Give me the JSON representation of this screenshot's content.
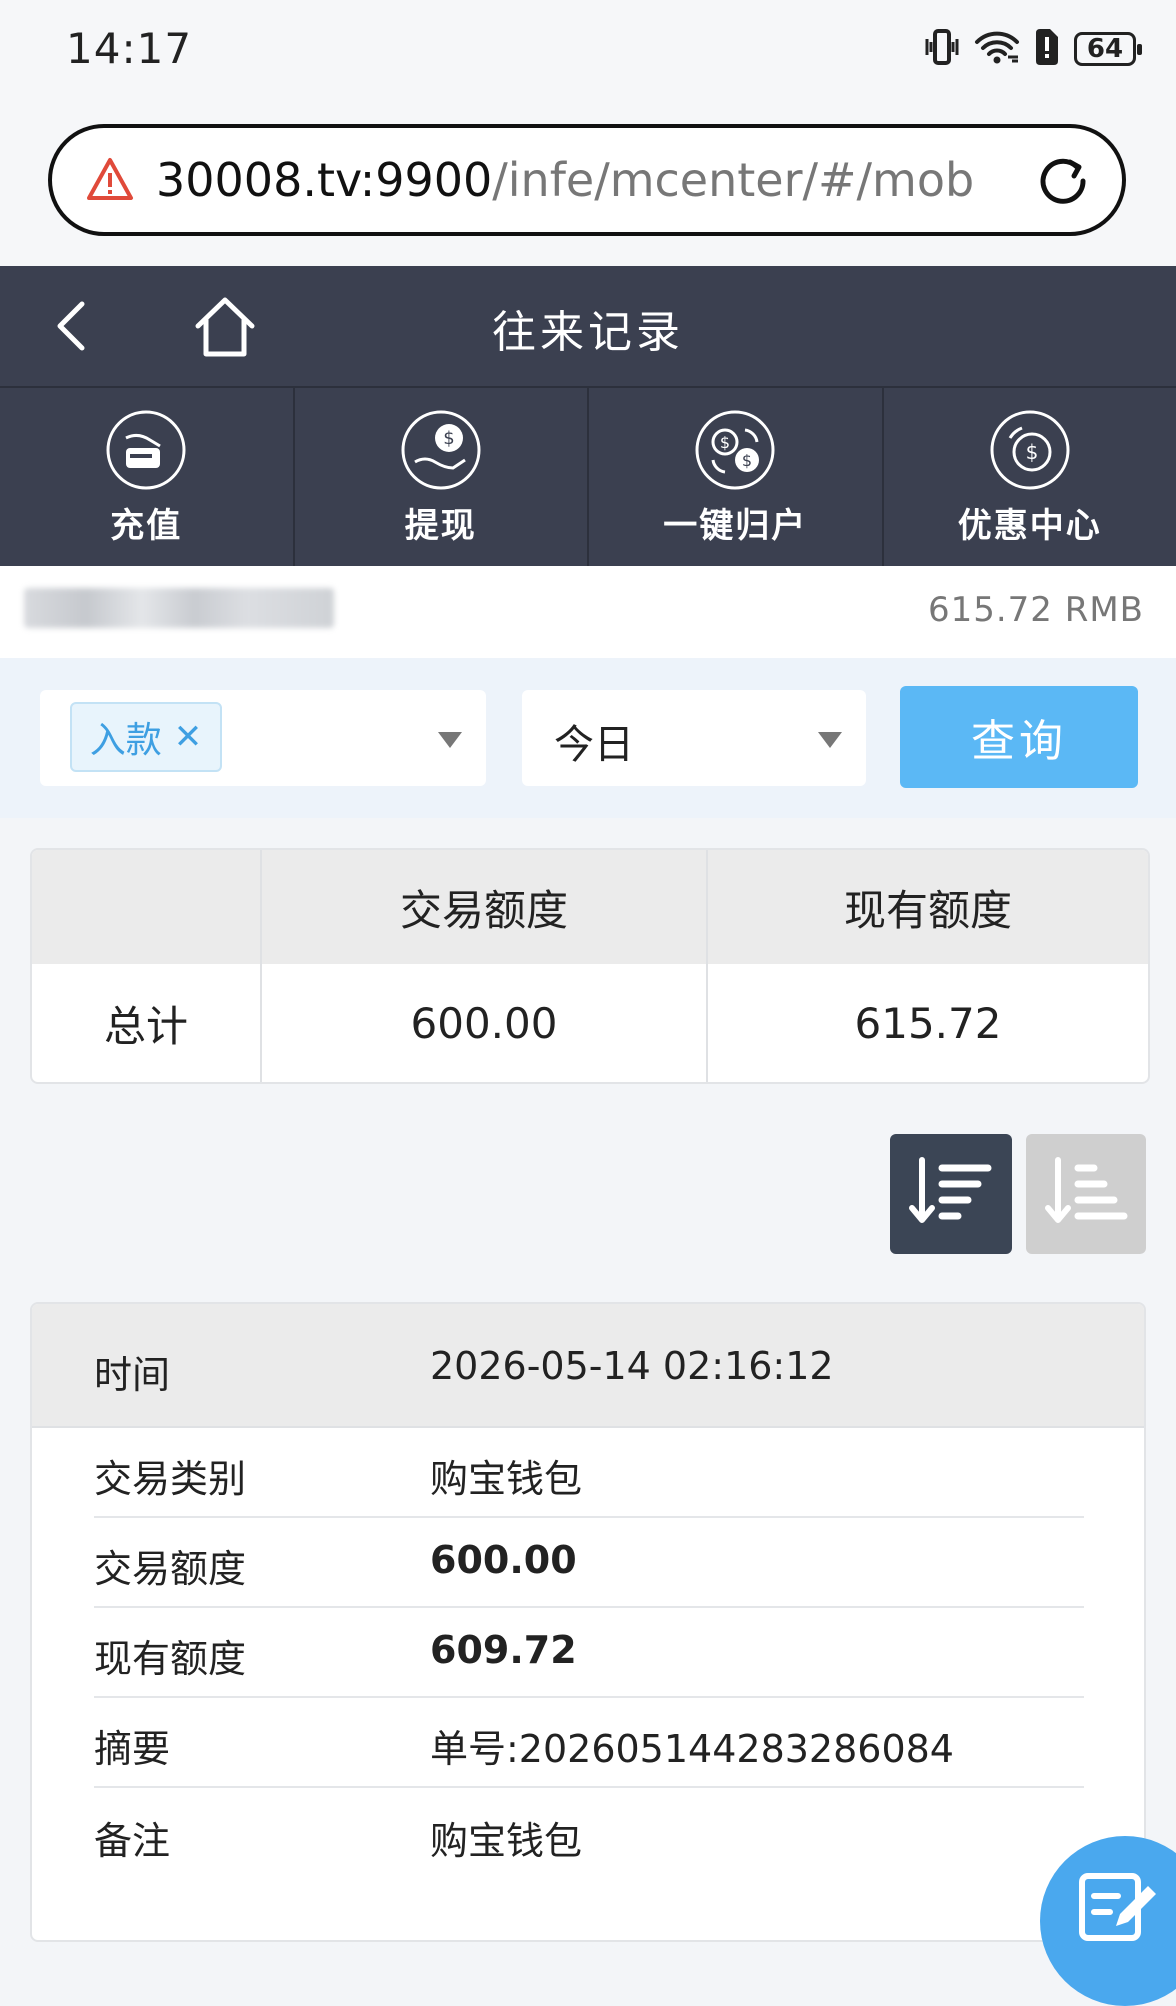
{
  "status_bar": {
    "time": "14:17",
    "battery": "64",
    "icons": [
      "vibrate-icon",
      "wifi-icon",
      "sim-alert-icon",
      "battery-icon"
    ]
  },
  "browser": {
    "url_host": "30008.tv:9900",
    "url_path": "/infe/mcenter/#/mobile/",
    "icons": [
      "warning-icon",
      "reload-icon"
    ]
  },
  "header": {
    "title": "往来记录",
    "icons": [
      "back-icon",
      "home-icon"
    ]
  },
  "actions": [
    {
      "label": "充值",
      "icon": "deposit-card-icon"
    },
    {
      "label": "提现",
      "icon": "withdraw-coin-icon"
    },
    {
      "label": "一键归户",
      "icon": "exchange-coins-icon"
    },
    {
      "label": "优惠中心",
      "icon": "rebate-coin-icon"
    }
  ],
  "balance": "615.72 RMB",
  "filters": {
    "type_tag": "入款",
    "type_tag_close": "✕",
    "date": "今日",
    "query_label": "查询"
  },
  "summary": {
    "headers": [
      "",
      "交易额度",
      "现有额度"
    ],
    "row_label": "总计",
    "trade_amount": "600.00",
    "current_amount": "615.72"
  },
  "sort": {
    "desc_icon": "sort-descending-icon",
    "asc_icon": "sort-ascending-icon"
  },
  "record": {
    "time_label": "时间",
    "time_value": "2026-05-14 02:16:12",
    "rows": [
      {
        "label": "交易类别",
        "value": "购宝钱包"
      },
      {
        "label": "交易额度",
        "value": "600.00"
      },
      {
        "label": "现有额度",
        "value": "609.72"
      },
      {
        "label": "摘要",
        "value": "单号:202605144283286084"
      },
      {
        "label": "备注",
        "value": "购宝钱包"
      }
    ]
  },
  "colors": {
    "nav_bg": "#3b4050",
    "accent": "#5bb8f5",
    "tag_text": "#3e9fe2",
    "sort_active": "#3b4555",
    "fab": "#4aa8ee"
  }
}
